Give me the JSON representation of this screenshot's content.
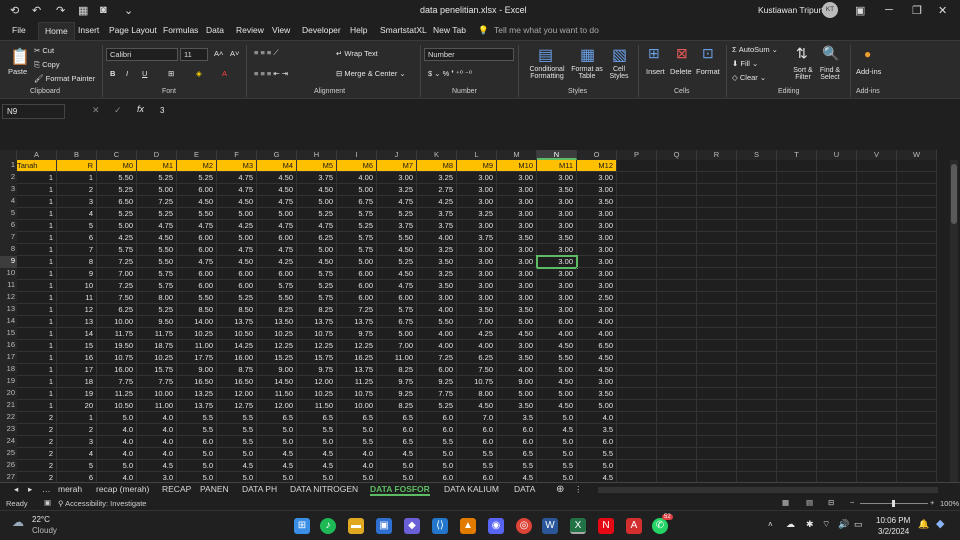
{
  "title": {
    "file": "data penelitian.xlsx",
    "app": "Excel",
    "user": "Kustiawan Tripurta",
    "initials": "KT"
  },
  "menu": [
    "File",
    "Home",
    "Insert",
    "Page Layout",
    "Formulas",
    "Data",
    "Review",
    "View",
    "Developer",
    "Help",
    "SmartstatXL",
    "New Tab"
  ],
  "tellme": "Tell me what you want to do",
  "ribbon": {
    "clipboard": {
      "paste": "Paste",
      "cut": "Cut",
      "copy": "Copy",
      "painter": "Format Painter",
      "label": "Clipboard"
    },
    "font": {
      "name": "Calibri",
      "size": "11",
      "label": "Font"
    },
    "alignment": {
      "wrap": "Wrap Text",
      "merge": "Merge & Center",
      "label": "Alignment"
    },
    "number": {
      "format": "Number",
      "label": "Number"
    },
    "styles": {
      "cond": "Conditional Formatting",
      "fmt": "Format as Table",
      "cell": "Cell Styles",
      "label": "Styles"
    },
    "cells": {
      "insert": "Insert",
      "delete": "Delete",
      "format": "Format",
      "label": "Cells"
    },
    "editing": {
      "autosum": "AutoSum",
      "fill": "Fill",
      "clear": "Clear",
      "sort": "Sort & Filter",
      "find": "Find & Select",
      "label": "Editing"
    },
    "addins": {
      "btn": "Add-ins",
      "label": "Add-ins"
    }
  },
  "namebox": "N9",
  "formula": "3",
  "columns": [
    "A",
    "B",
    "C",
    "D",
    "E",
    "F",
    "G",
    "H",
    "I",
    "J",
    "K",
    "L",
    "M",
    "N",
    "O",
    "P",
    "Q",
    "R",
    "S",
    "T",
    "U",
    "V",
    "W"
  ],
  "headers": [
    "Tanah",
    "R",
    "M0",
    "M1",
    "M2",
    "M3",
    "M4",
    "M5",
    "M6",
    "M7",
    "M8",
    "M9",
    "M10",
    "M11",
    "M12"
  ],
  "rows": [
    [
      "1",
      "1",
      "5.50",
      "5.25",
      "5.25",
      "4.75",
      "4.50",
      "3.75",
      "4.00",
      "3.00",
      "3.25",
      "3.00",
      "3.00",
      "3.00",
      "3.00"
    ],
    [
      "1",
      "2",
      "5.25",
      "5.00",
      "6.00",
      "4.75",
      "4.50",
      "4.50",
      "5.00",
      "3.25",
      "2.75",
      "3.00",
      "3.00",
      "3.50",
      "3.00"
    ],
    [
      "1",
      "3",
      "6.50",
      "7.25",
      "4.50",
      "4.50",
      "4.75",
      "5.00",
      "6.75",
      "4.75",
      "4.25",
      "3.00",
      "3.00",
      "3.00",
      "3.50"
    ],
    [
      "1",
      "4",
      "5.25",
      "5.25",
      "5.50",
      "5.00",
      "5.00",
      "5.25",
      "5.75",
      "5.25",
      "3.75",
      "3.25",
      "3.00",
      "3.00",
      "3.00"
    ],
    [
      "1",
      "5",
      "5.00",
      "4.75",
      "4.75",
      "4.25",
      "4.75",
      "4.75",
      "5.25",
      "3.75",
      "3.75",
      "3.00",
      "3.00",
      "3.00",
      "3.00"
    ],
    [
      "1",
      "6",
      "4.25",
      "4.50",
      "6.00",
      "5.00",
      "6.00",
      "6.25",
      "5.75",
      "5.50",
      "4.00",
      "3.75",
      "3.50",
      "3.50",
      "3.00"
    ],
    [
      "1",
      "7",
      "5.75",
      "5.50",
      "6.00",
      "4.75",
      "4.75",
      "5.00",
      "5.75",
      "4.50",
      "3.25",
      "3.00",
      "3.00",
      "3.00",
      "3.00"
    ],
    [
      "1",
      "8",
      "7.25",
      "5.50",
      "4.75",
      "4.50",
      "4.25",
      "4.50",
      "5.00",
      "5.25",
      "3.50",
      "3.00",
      "3.00",
      "3.00",
      "3.00"
    ],
    [
      "1",
      "9",
      "7.00",
      "5.75",
      "6.00",
      "6.00",
      "6.00",
      "5.75",
      "6.00",
      "4.50",
      "3.25",
      "3.00",
      "3.00",
      "3.00",
      "3.00"
    ],
    [
      "1",
      "10",
      "7.25",
      "5.75",
      "6.00",
      "6.00",
      "5.75",
      "5.25",
      "6.00",
      "4.75",
      "3.50",
      "3.00",
      "3.00",
      "3.00",
      "3.00"
    ],
    [
      "1",
      "11",
      "7.50",
      "8.00",
      "5.50",
      "5.25",
      "5.50",
      "5.75",
      "6.00",
      "6.00",
      "3.00",
      "3.00",
      "3.00",
      "3.00",
      "2.50"
    ],
    [
      "1",
      "12",
      "6.25",
      "5.25",
      "8.50",
      "8.50",
      "8.25",
      "8.25",
      "7.25",
      "5.75",
      "4.00",
      "3.50",
      "3.50",
      "3.00",
      "3.00"
    ],
    [
      "1",
      "13",
      "10.00",
      "9.50",
      "14.00",
      "13.75",
      "13.50",
      "13.75",
      "13.75",
      "6.75",
      "5.50",
      "7.00",
      "5.00",
      "6.00",
      "4.00"
    ],
    [
      "1",
      "14",
      "11.75",
      "11.75",
      "10.25",
      "10.50",
      "10.25",
      "10.75",
      "9.75",
      "5.00",
      "4.00",
      "4.25",
      "4.50",
      "4.00",
      "4.00"
    ],
    [
      "1",
      "15",
      "19.50",
      "18.75",
      "11.00",
      "14.25",
      "12.25",
      "12.25",
      "12.25",
      "7.00",
      "4.00",
      "4.00",
      "3.00",
      "4.50",
      "6.50"
    ],
    [
      "1",
      "16",
      "10.75",
      "10.25",
      "17.75",
      "16.00",
      "15.25",
      "15.75",
      "16.25",
      "11.00",
      "7.25",
      "6.25",
      "3.50",
      "5.50",
      "4.50"
    ],
    [
      "1",
      "17",
      "16.00",
      "15.75",
      "9.00",
      "8.75",
      "9.00",
      "9.75",
      "13.75",
      "8.25",
      "6.00",
      "7.50",
      "4.00",
      "5.00",
      "4.50"
    ],
    [
      "1",
      "18",
      "7.75",
      "7.75",
      "16.50",
      "16.50",
      "14.50",
      "12.00",
      "11.25",
      "9.75",
      "9.25",
      "10.75",
      "9.00",
      "4.50",
      "3.00"
    ],
    [
      "1",
      "19",
      "11.25",
      "10.00",
      "13.25",
      "12.00",
      "11.50",
      "10.25",
      "10.75",
      "9.25",
      "7.75",
      "8.00",
      "5.00",
      "5.00",
      "3.50"
    ],
    [
      "1",
      "20",
      "10.50",
      "11.00",
      "13.75",
      "12.75",
      "12.00",
      "11.50",
      "10.00",
      "8.25",
      "5.25",
      "4.50",
      "3.50",
      "4.50",
      "5.00"
    ],
    [
      "2",
      "1",
      "5.0",
      "4.0",
      "5.5",
      "5.5",
      "6.5",
      "6.5",
      "6.5",
      "6.5",
      "6.0",
      "7.0",
      "3.5",
      "5.0",
      "4.0"
    ],
    [
      "2",
      "2",
      "4.0",
      "4.0",
      "5.5",
      "5.5",
      "5.0",
      "5.5",
      "5.0",
      "6.0",
      "6.0",
      "6.0",
      "6.0",
      "4.5",
      "3.5"
    ],
    [
      "2",
      "3",
      "4.0",
      "4.0",
      "6.0",
      "5.5",
      "5.0",
      "5.0",
      "5.5",
      "6.5",
      "5.5",
      "6.0",
      "6.0",
      "5.0",
      "6.0"
    ],
    [
      "2",
      "4",
      "4.0",
      "4.0",
      "5.0",
      "5.0",
      "4.5",
      "4.5",
      "4.0",
      "4.5",
      "5.0",
      "5.5",
      "6.5",
      "5.0",
      "5.5"
    ],
    [
      "2",
      "5",
      "5.0",
      "4.5",
      "5.0",
      "4.5",
      "4.5",
      "4.5",
      "4.0",
      "5.0",
      "5.0",
      "5.5",
      "5.5",
      "5.5",
      "5.0"
    ],
    [
      "2",
      "6",
      "4.0",
      "3.0",
      "5.0",
      "5.0",
      "5.0",
      "5.0",
      "5.0",
      "5.0",
      "6.0",
      "6.0",
      "4.5",
      "5.0",
      "4.5"
    ]
  ],
  "sheets": [
    "merah",
    "recap (merah)",
    "RECAP",
    "PANEN",
    "DATA PH",
    "DATA NITROGEN",
    "DATA FOSFOR",
    "DATA KALIUM",
    "DATA"
  ],
  "active_sheet": "DATA FOSFOR",
  "status": {
    "ready": "Ready",
    "access": "Accessibility: Investigate",
    "zoom": "100%"
  },
  "taskbar": {
    "temp": "22°C",
    "weather": "Cloudy",
    "time": "10:06 PM",
    "date": "3/2/2024",
    "badge": "52"
  }
}
